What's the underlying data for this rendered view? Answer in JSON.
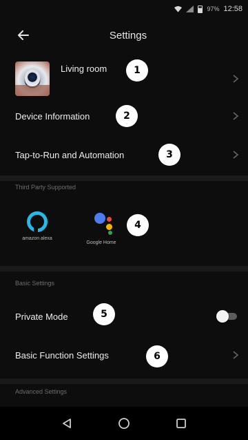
{
  "status_bar": {
    "battery_percent": "97%",
    "time": "12:58"
  },
  "header": {
    "title": "Settings"
  },
  "device": {
    "name": "Living room"
  },
  "rows": {
    "device_information": "Device Information",
    "tap_to_run": "Tap-to-Run and Automation",
    "private_mode": "Private Mode",
    "basic_function_settings": "Basic Function Settings"
  },
  "sections": {
    "third_party": "Third Party Supported",
    "basic_settings": "Basic Settings",
    "advanced_settings": "Advanced Settings"
  },
  "third_party": {
    "alexa_label": "amazon alexa",
    "google_label": "Google Home"
  },
  "private_mode_enabled": false,
  "badges": [
    "1",
    "2",
    "3",
    "4",
    "5",
    "6"
  ],
  "colors": {
    "background": "#0d0d0d",
    "badge_bg": "#ffffff",
    "alexa_blue": "#2ab7e6",
    "google_blue": "#4d7bf0",
    "google_red": "#e74c3c",
    "google_yellow": "#f4b400",
    "google_green": "#2ea44f"
  },
  "icons": {
    "back": "arrow-left-icon",
    "chevron": "chevron-right-icon",
    "nav_back": "triangle-back-icon",
    "nav_home": "circle-home-icon",
    "nav_recents": "square-recents-icon"
  }
}
